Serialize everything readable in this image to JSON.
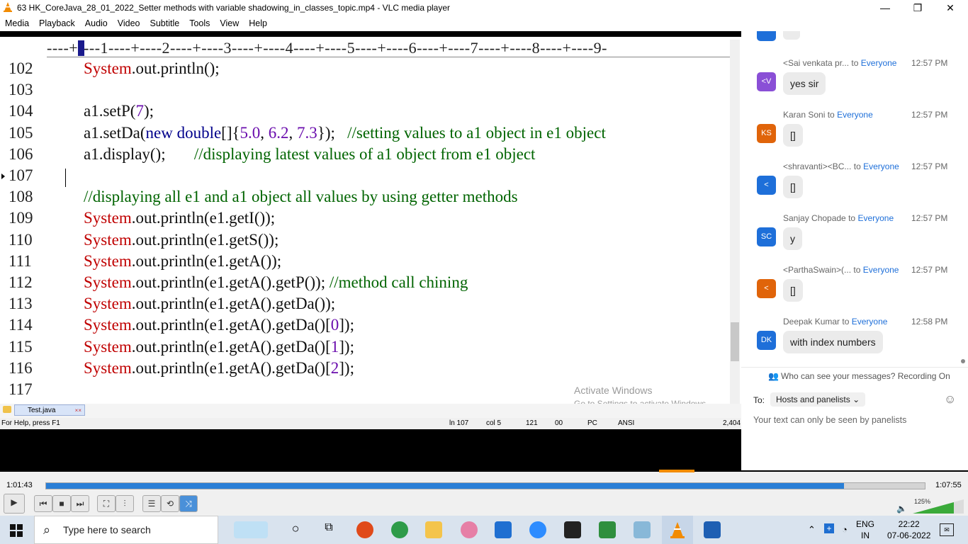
{
  "window": {
    "title": "63 HK_CoreJava_28_01_2022_Setter methods with variable shadowing_in_classes_topic.mp4 - VLC media player",
    "minimize": "—",
    "restore": "❐",
    "close": "✕"
  },
  "menu": [
    "Media",
    "Playback",
    "Audio",
    "Video",
    "Subtitle",
    "Tools",
    "View",
    "Help"
  ],
  "editor": {
    "ruler": "----+----1----+----2----+----3----+----4----+----5----+----6----+----7----+----8----+----9-",
    "lines": [
      {
        "n": "102",
        "segs": [
          [
            "sys",
            "System"
          ],
          [
            "txt",
            ".out.println();"
          ]
        ]
      },
      {
        "n": "103",
        "segs": []
      },
      {
        "n": "104",
        "segs": [
          [
            "txt",
            "a1.setP("
          ],
          [
            "num",
            "7"
          ],
          [
            "txt",
            ");"
          ]
        ]
      },
      {
        "n": "105",
        "segs": [
          [
            "txt",
            "a1.setDa("
          ],
          [
            "new",
            "new double"
          ],
          [
            "txt",
            "[]{"
          ],
          [
            "num",
            "5.0"
          ],
          [
            "txt",
            ", "
          ],
          [
            "num",
            "6.2"
          ],
          [
            "txt",
            ", "
          ],
          [
            "num",
            "7.3"
          ],
          [
            "txt",
            "});   "
          ],
          [
            "cmt",
            "//setting values to a1 object in e1 object"
          ]
        ]
      },
      {
        "n": "106",
        "segs": [
          [
            "txt",
            "a1.display();       "
          ],
          [
            "cmt",
            "//displaying latest values of a1 object from e1 object"
          ]
        ]
      },
      {
        "n": "107",
        "segs": []
      },
      {
        "n": "108",
        "segs": [
          [
            "cmt",
            "//displaying all e1 and a1 object all values by using getter methods"
          ]
        ]
      },
      {
        "n": "109",
        "segs": [
          [
            "sys",
            "System"
          ],
          [
            "txt",
            ".out.println(e1.getI());"
          ]
        ]
      },
      {
        "n": "110",
        "segs": [
          [
            "sys",
            "System"
          ],
          [
            "txt",
            ".out.println(e1.getS());"
          ]
        ]
      },
      {
        "n": "111",
        "segs": [
          [
            "sys",
            "System"
          ],
          [
            "txt",
            ".out.println(e1.getA());"
          ]
        ]
      },
      {
        "n": "112",
        "segs": [
          [
            "sys",
            "System"
          ],
          [
            "txt",
            ".out.println(e1.getA().getP()); "
          ],
          [
            "cmt",
            "//method call chining"
          ]
        ]
      },
      {
        "n": "113",
        "segs": [
          [
            "sys",
            "System"
          ],
          [
            "txt",
            ".out.println(e1.getA().getDa());"
          ]
        ]
      },
      {
        "n": "114",
        "segs": [
          [
            "sys",
            "System"
          ],
          [
            "txt",
            ".out.println(e1.getA().getDa()["
          ],
          [
            "num",
            "0"
          ],
          [
            "txt",
            "]);"
          ]
        ]
      },
      {
        "n": "115",
        "segs": [
          [
            "sys",
            "System"
          ],
          [
            "txt",
            ".out.println(e1.getA().getDa()["
          ],
          [
            "num",
            "1"
          ],
          [
            "txt",
            "]);"
          ]
        ]
      },
      {
        "n": "116",
        "segs": [
          [
            "sys",
            "System"
          ],
          [
            "txt",
            ".out.println(e1.getA().getDa()["
          ],
          [
            "num",
            "2"
          ],
          [
            "txt",
            "]);"
          ]
        ]
      },
      {
        "n": "117",
        "segs": []
      }
    ],
    "tab": "Test.java",
    "tab_close": "××",
    "watermark_line1": "Activate Windows",
    "watermark_line2": "Go to Settings to activate Windows."
  },
  "status": {
    "help": "For Help, press F1",
    "ln": "ln 107",
    "col": "col 5",
    "code": "121",
    "hex": "00",
    "mode": "PC",
    "enc": "ANSI",
    "size": "2,404"
  },
  "chat": {
    "messages": [
      {
        "sender": "<Sai venkata pr...",
        "to": "to",
        "target": "Everyone",
        "time": "12:57 PM",
        "avatar": "<V",
        "color": "#8a4fd6",
        "text": "yes sir"
      },
      {
        "sender": "Karan Soni",
        "to": "to",
        "target": "Everyone",
        "time": "12:57 PM",
        "avatar": "KS",
        "color": "#e0640a",
        "text": "[]"
      },
      {
        "sender": "<shravanti><BC...",
        "to": "to",
        "target": "Everyone",
        "time": "12:57 PM",
        "avatar": "<",
        "color": "#1e6fd9",
        "text": "[]"
      },
      {
        "sender": "Sanjay Chopade",
        "to": "to",
        "target": "Everyone",
        "time": "12:57 PM",
        "avatar": "SC",
        "color": "#1e6fd9",
        "text": "y"
      },
      {
        "sender": "<ParthaSwain>(...",
        "to": "to",
        "target": "Everyone",
        "time": "12:57 PM",
        "avatar": "<",
        "color": "#e0640a",
        "text": "[]"
      },
      {
        "sender": "Deepak Kumar",
        "to": "to",
        "target": "Everyone",
        "time": "12:58 PM",
        "avatar": "DK",
        "color": "#1e6fd9",
        "text": "with index numbers"
      }
    ],
    "privacy": "Who can see your messages? Recording On",
    "to_label": "To:",
    "to_value": "Hosts and panelists",
    "hint": "Your text can only be seen by panelists"
  },
  "player": {
    "elapsed": "1:01:43",
    "total": "1:07:55",
    "progress": 0.908,
    "volume": "125%"
  },
  "taskbar": {
    "search_placeholder": "Type here to search",
    "lang_top": "ENG",
    "lang_bottom": "IN",
    "time": "22:22",
    "date": "07-06-2022"
  }
}
